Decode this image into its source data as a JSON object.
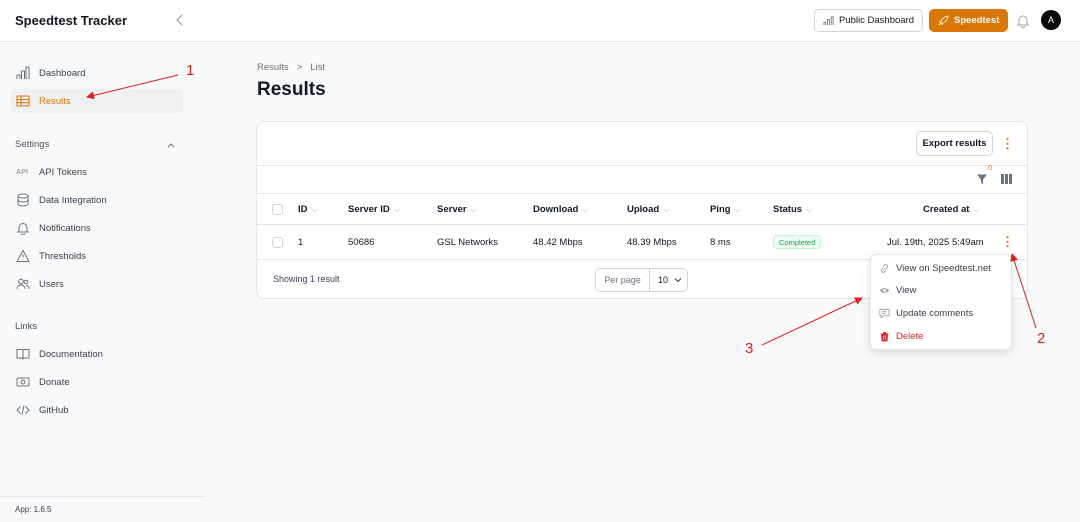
{
  "topbar": {
    "app_title": "Speedtest Tracker",
    "public_dashboard_label": "Public Dashboard",
    "speedtest_label": "Speedtest",
    "avatar_initial": "A"
  },
  "sidebar": {
    "items": [
      {
        "label": "Dashboard",
        "icon": "bar-chart-icon"
      },
      {
        "label": "Results",
        "icon": "table-icon"
      }
    ],
    "settings_group": "Settings",
    "settings_items": [
      {
        "label": "API Tokens",
        "icon_text": "API"
      },
      {
        "label": "Data Integration",
        "icon": "database-icon"
      },
      {
        "label": "Notifications",
        "icon": "bell-icon"
      },
      {
        "label": "Thresholds",
        "icon": "warning-icon"
      },
      {
        "label": "Users",
        "icon": "users-icon"
      }
    ],
    "links_group": "Links",
    "links_items": [
      {
        "label": "Documentation",
        "icon": "book-icon"
      },
      {
        "label": "Donate",
        "icon": "money-icon"
      },
      {
        "label": "GitHub",
        "icon": "code-icon"
      }
    ],
    "version": "App: 1.6.5"
  },
  "breadcrumb": {
    "items": [
      "Results",
      "List"
    ],
    "separator": ">"
  },
  "page_title": "Results",
  "table": {
    "export_label": "Export results",
    "filter_count": "0",
    "columns": [
      "ID",
      "Server ID",
      "Server",
      "Download",
      "Upload",
      "Ping",
      "Status",
      "Created at"
    ],
    "rows": [
      {
        "id": "1",
        "server_id": "50686",
        "server": "GSL Networks",
        "download": "48.42 Mbps",
        "upload": "48.39 Mbps",
        "ping": "8 ms",
        "status": "Completed",
        "created_at": "Jul. 19th, 2025 5:49am"
      }
    ],
    "showing": "Showing 1 result",
    "per_page_label": "Per page",
    "per_page_value": "10"
  },
  "row_menu": {
    "items": [
      {
        "label": "View on Speedtest.net",
        "icon": "link-icon"
      },
      {
        "label": "View",
        "icon": "eye-icon"
      },
      {
        "label": "Update comments",
        "icon": "comment-icon"
      },
      {
        "label": "Delete",
        "icon": "trash-icon"
      }
    ]
  },
  "annotations": {
    "one": "1",
    "two": "2",
    "three": "3"
  },
  "colors": {
    "accent": "#d97706",
    "danger": "#dc2626",
    "success": "#16a34a",
    "annotation": "#e11d1d"
  }
}
